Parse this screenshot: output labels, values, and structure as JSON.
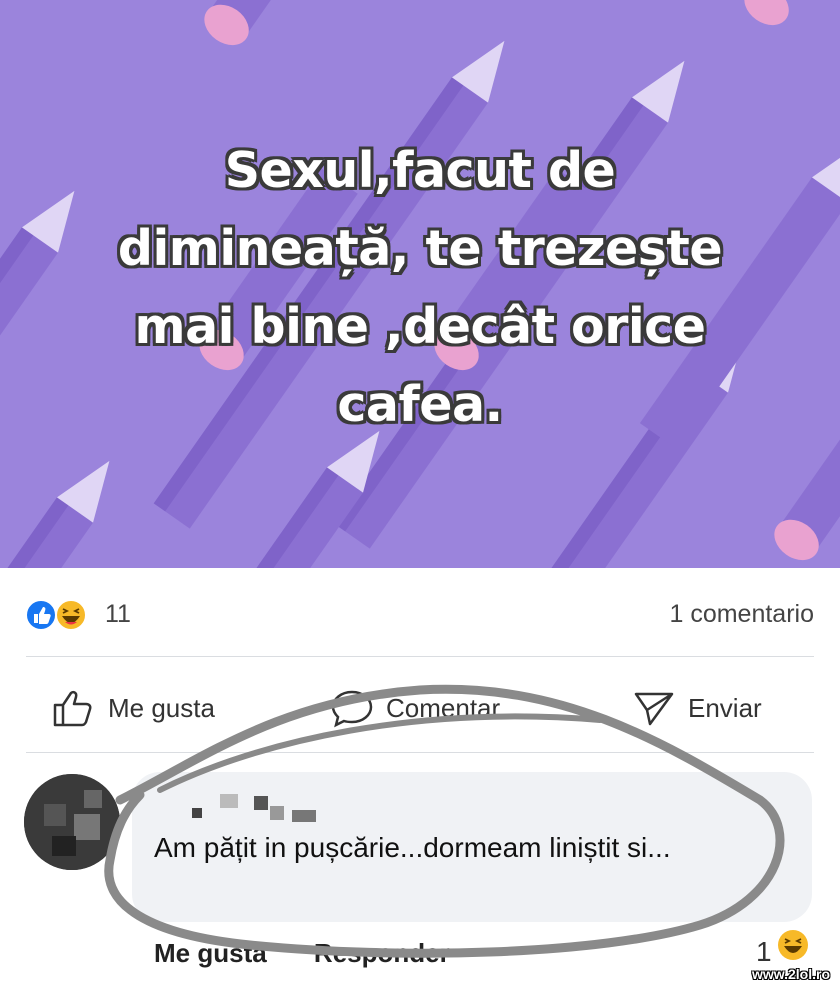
{
  "post": {
    "text": "Sexul,facut de\ndimineață, te trezește\nmai bine ,decât orice\ncafea.",
    "background_color": "#9b84dc"
  },
  "reactions": {
    "icons": [
      "like-icon",
      "haha-icon"
    ],
    "count": "11",
    "comments": "1 comentario"
  },
  "actions": {
    "like": "Me gusta",
    "comment": "Comentar",
    "share": "Enviar"
  },
  "comment": {
    "text": "Am pățit in pușcărie...dormeam liniștit si...",
    "like": "Me gusta",
    "reply": "Responder",
    "reaction_count": "1",
    "reaction_icon": "haha-icon"
  },
  "watermark": "www.2lol.ro"
}
